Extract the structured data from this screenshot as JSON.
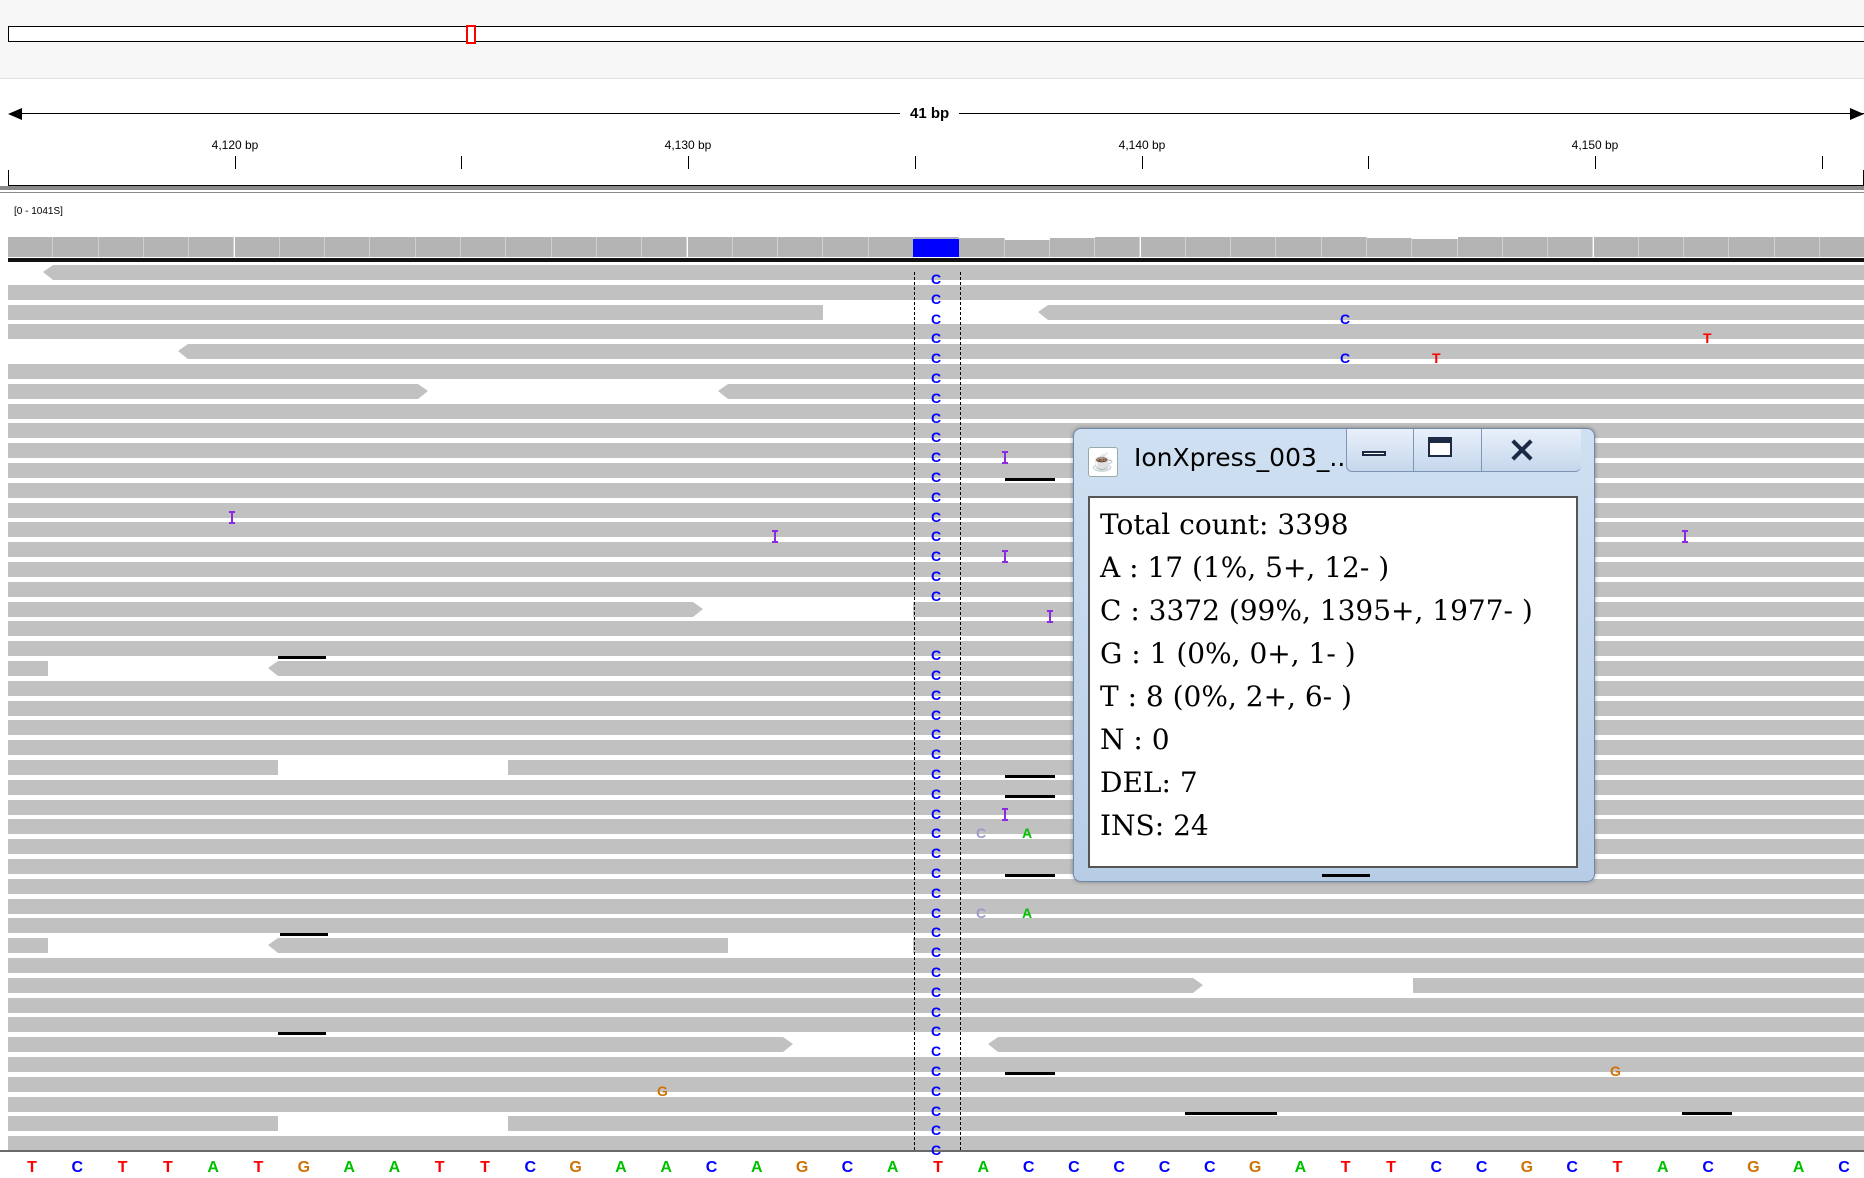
{
  "window": {
    "title": "IonXpress_003_..."
  },
  "ruler": {
    "span_label": "41 bp",
    "ticks": [
      "4,120 bp",
      "4,130 bp",
      "4,140 bp",
      "4,150 bp"
    ]
  },
  "coverage": {
    "range_label": "[0 - 1041S]"
  },
  "center_column": {
    "read_base": "C"
  },
  "mismatch_bases": [
    "C",
    "T",
    "G",
    "A"
  ],
  "popup": {
    "title": "IonXpress_003_...",
    "lines": [
      "Total count: 3398",
      "A : 17 (1%, 5+, 12- )",
      "C : 3372 (99%, 1395+, 1977- )",
      "G : 1 (0%, 0+, 1- )",
      "T : 8 (0%, 2+, 6- )",
      "N : 0",
      "DEL: 7",
      "INS: 24"
    ]
  },
  "reference_sequence": "TCTTATGAATTCGAACAGCATACCCCCGATTCCGCTACGAC",
  "colors": {
    "A": "#00c000",
    "C": "#0000ff",
    "G": "#d17105",
    "T": "#ff0000",
    "read": "#c1c1c1",
    "coverage": "#b4b4b4",
    "insertion": "#8a2be2"
  }
}
